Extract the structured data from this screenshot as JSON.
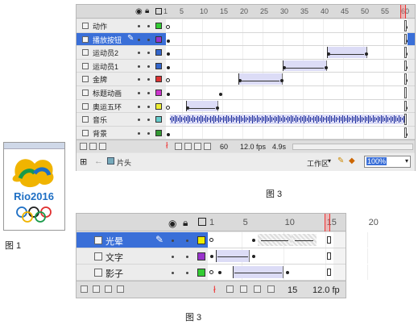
{
  "panel1": {
    "ruler_ticks": [
      "1",
      "5",
      "10",
      "15",
      "20",
      "25",
      "30",
      "35",
      "40",
      "45",
      "50",
      "55",
      "60"
    ],
    "layers": [
      {
        "name": "动作",
        "color": "#33cc33"
      },
      {
        "name": "播放按钮",
        "color": "#9933cc",
        "selected": true
      },
      {
        "name": "运动员2",
        "color": "#3366cc"
      },
      {
        "name": "运动员1",
        "color": "#3366cc"
      },
      {
        "name": "金牌",
        "color": "#dd3333"
      },
      {
        "name": "标题动画",
        "color": "#cc33cc"
      },
      {
        "name": "奥运五环",
        "color": "#eeee33"
      },
      {
        "name": "音乐",
        "color": "#66cccc"
      },
      {
        "name": "背景",
        "color": "#339933"
      }
    ],
    "status": {
      "frame": "60",
      "fps": "12.0 fps",
      "time": "4.9s"
    },
    "scene": {
      "name": "片头",
      "workspace": "工作区",
      "zoom": "100%"
    }
  },
  "panel2": {
    "ruler_ticks": [
      "1",
      "5",
      "10",
      "15",
      "20"
    ],
    "layers": [
      {
        "name": "光晕",
        "color": "#eeee00",
        "selected": true
      },
      {
        "name": "文字",
        "color": "#9933cc"
      },
      {
        "name": "影子",
        "color": "#33cc33"
      }
    ],
    "status": {
      "frame": "15",
      "fps": "12.0 fp"
    }
  },
  "captions": {
    "fig1": "图 1",
    "fig3_top": "图 3",
    "fig3_bottom": "图 3"
  },
  "logo": {
    "text": "Rio2016"
  }
}
